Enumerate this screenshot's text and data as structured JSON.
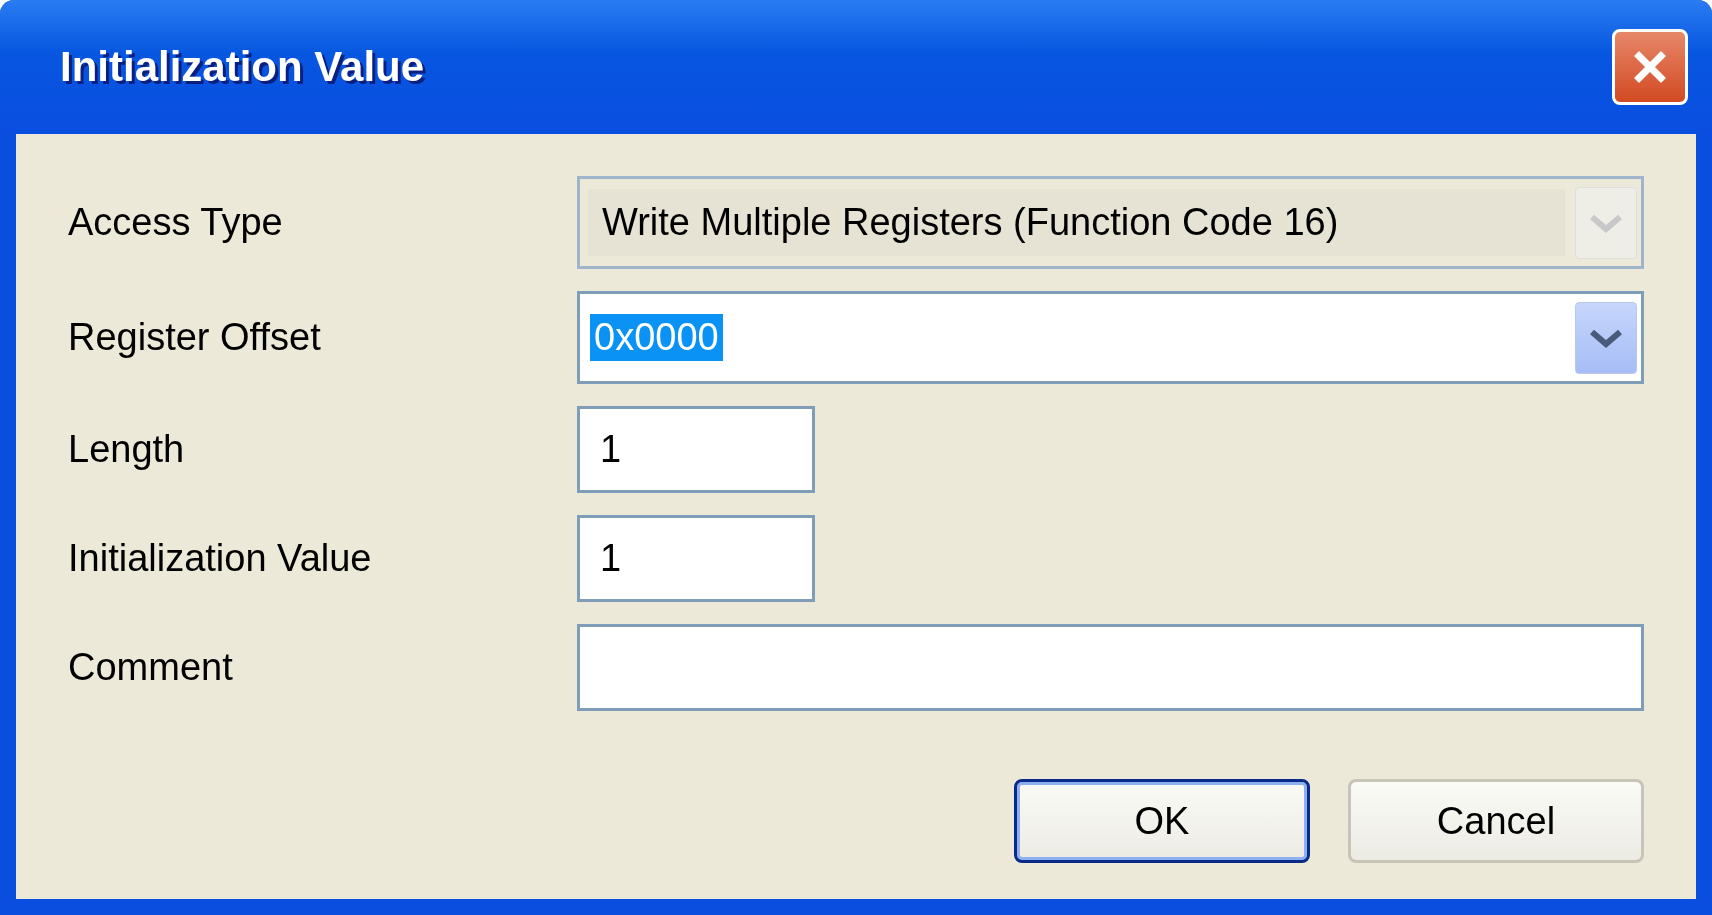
{
  "window": {
    "title": "Initialization Value"
  },
  "fields": [
    {
      "label": "Access Type",
      "kind": "combo",
      "value": "Write Multiple Registers (Function Code 16)",
      "disabled": true,
      "highlighted": false
    },
    {
      "label": "Register Offset",
      "kind": "combo",
      "value": "0x0000",
      "disabled": false,
      "highlighted": true
    },
    {
      "label": "Length",
      "kind": "short",
      "value": "1"
    },
    {
      "label": "Initialization Value",
      "kind": "short",
      "value": "1"
    },
    {
      "label": "Comment",
      "kind": "wide"
    }
  ],
  "buttons": [
    {
      "label": "OK",
      "default": true
    },
    {
      "label": "Cancel",
      "default": false
    }
  ]
}
